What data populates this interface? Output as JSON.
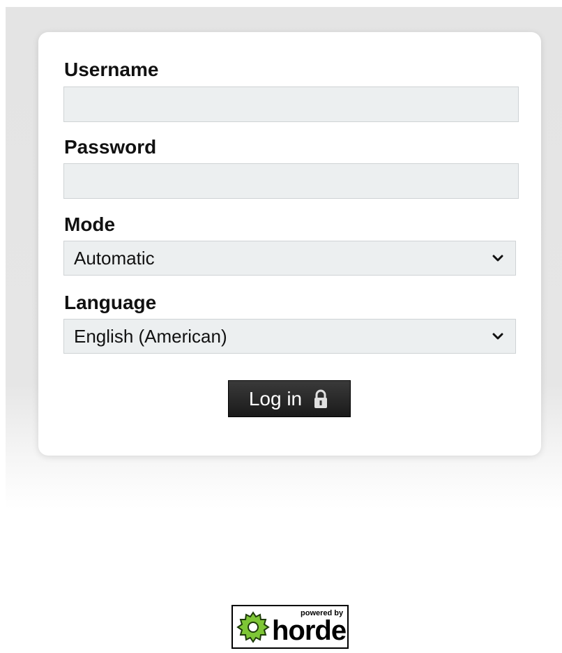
{
  "login_form": {
    "username": {
      "label": "Username",
      "value": "",
      "placeholder": ""
    },
    "password": {
      "label": "Password",
      "value": "",
      "placeholder": ""
    },
    "mode": {
      "label": "Mode",
      "selected": "Automatic"
    },
    "language": {
      "label": "Language",
      "selected": "English (American)"
    },
    "submit": {
      "label": "Log in",
      "icon": "lock-icon"
    }
  },
  "footer": {
    "badge": {
      "powered_by": "powered by",
      "brand": "horde",
      "icon": "gear-icon",
      "colors": {
        "gear": "#7ec636",
        "border": "#000000"
      }
    }
  },
  "colors": {
    "field_background": "#eceff0",
    "button_background": "#222222",
    "button_text": "#ffffff"
  }
}
